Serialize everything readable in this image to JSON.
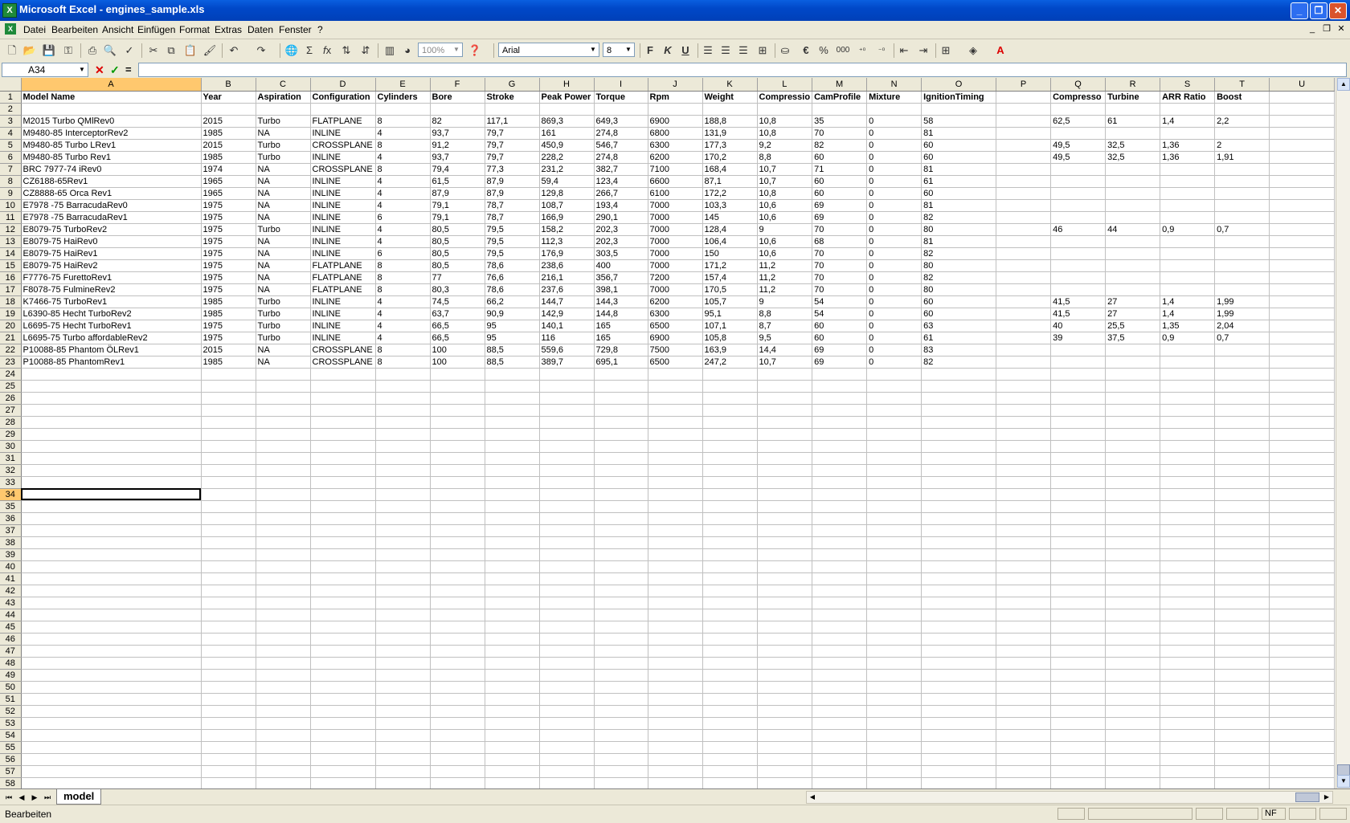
{
  "window": {
    "title": "Microsoft Excel - engines_sample.xls"
  },
  "menu": [
    "Datei",
    "Bearbeiten",
    "Ansicht",
    "Einfügen",
    "Format",
    "Extras",
    "Daten",
    "Fenster",
    "?"
  ],
  "toolbar": {
    "zoom": "100%",
    "font": "Arial",
    "font_size": "8"
  },
  "formula_bar": {
    "name_box": "A34",
    "formula": ""
  },
  "sheet": {
    "columns": [
      "A",
      "B",
      "C",
      "D",
      "E",
      "F",
      "G",
      "H",
      "I",
      "J",
      "K",
      "L",
      "M",
      "N",
      "O",
      "P",
      "Q",
      "R",
      "S",
      "T",
      "U"
    ],
    "active_cell": {
      "row": 34,
      "col": "A"
    },
    "total_rows": 58,
    "rows": [
      [
        "Model Name",
        "Year",
        "Aspiration",
        "Configuration",
        "Cylinders",
        "Bore",
        "Stroke",
        "Peak Power",
        "Torque",
        "Rpm",
        "Weight",
        "Compressio",
        "CamProfile",
        "Mixture",
        "IgnitionTiming",
        "",
        "Compresso",
        "Turbine",
        "ARR Ratio",
        "Boost",
        ""
      ],
      [],
      [
        " M2015 Turbo QMlRev0",
        "2015",
        "Turbo",
        "FLATPLANE",
        "8",
        "82",
        "117,1",
        "869,3",
        "649,3",
        "6900",
        "188,8",
        "10,8",
        "35",
        "0",
        "58",
        "",
        "62,5",
        "61",
        "1,4",
        "2,2",
        ""
      ],
      [
        " M9480-85 InterceptorRev2",
        "1985",
        "NA",
        "INLINE",
        "4",
        "93,7",
        "79,7",
        "161",
        "274,8",
        "6800",
        "131,9",
        "10,8",
        "70",
        "0",
        "81",
        "",
        "",
        "",
        "",
        "",
        ""
      ],
      [
        " M9480-85 Turbo  LRev1",
        "2015",
        "Turbo",
        "CROSSPLANE",
        "8",
        "91,2",
        "79,7",
        "450,9",
        "546,7",
        "6300",
        "177,3",
        "9,2",
        "82",
        "0",
        "60",
        "",
        "49,5",
        "32,5",
        "1,36",
        "2",
        ""
      ],
      [
        " M9480-85 Turbo Rev1",
        "1985",
        "Turbo",
        "INLINE",
        "4",
        "93,7",
        "79,7",
        "228,2",
        "274,8",
        "6200",
        "170,2",
        "8,8",
        "60",
        "0",
        "60",
        "",
        "49,5",
        "32,5",
        "1,36",
        "1,91",
        ""
      ],
      [
        "BRC 7977-74 iRev0",
        "1974",
        "NA",
        "CROSSPLANE",
        "8",
        "79,4",
        "77,3",
        "231,2",
        "382,7",
        "7100",
        "168,4",
        "10,7",
        "71",
        "0",
        "81",
        "",
        "",
        "",
        "",
        "",
        ""
      ],
      [
        "CZ6188-65Rev1",
        "1965",
        "NA",
        "INLINE",
        "4",
        "61,5",
        "87,9",
        "59,4",
        "123,4",
        "6600",
        "87,1",
        "10,7",
        "60",
        "0",
        "61",
        "",
        "",
        "",
        "",
        "",
        ""
      ],
      [
        "CZ8888-65 Orca Rev1",
        "1965",
        "NA",
        "INLINE",
        "4",
        "87,9",
        "87,9",
        "129,8",
        "266,7",
        "6100",
        "172,2",
        "10,8",
        "60",
        "0",
        "60",
        "",
        "",
        "",
        "",
        "",
        ""
      ],
      [
        "E7978 -75 BarracudaRev0",
        "1975",
        "NA",
        "INLINE",
        "4",
        "79,1",
        "78,7",
        "108,7",
        "193,4",
        "7000",
        "103,3",
        "10,6",
        "69",
        "0",
        "81",
        "",
        "",
        "",
        "",
        "",
        ""
      ],
      [
        "E7978 -75 BarracudaRev1",
        "1975",
        "NA",
        "INLINE",
        "6",
        "79,1",
        "78,7",
        "166,9",
        "290,1",
        "7000",
        "145",
        "10,6",
        "69",
        "0",
        "82",
        "",
        "",
        "",
        "",
        "",
        ""
      ],
      [
        "E8079-75  TurboRev2",
        "1975",
        "Turbo",
        "INLINE",
        "4",
        "80,5",
        "79,5",
        "158,2",
        "202,3",
        "7000",
        "128,4",
        "9",
        "70",
        "0",
        "80",
        "",
        "46",
        "44",
        "0,9",
        "0,7",
        ""
      ],
      [
        "E8079-75 HaiRev0",
        "1975",
        "NA",
        "INLINE",
        "4",
        "80,5",
        "79,5",
        "112,3",
        "202,3",
        "7000",
        "106,4",
        "10,6",
        "68",
        "0",
        "81",
        "",
        "",
        "",
        "",
        "",
        ""
      ],
      [
        "E8079-75 HaiRev1",
        "1975",
        "NA",
        "INLINE",
        "6",
        "80,5",
        "79,5",
        "176,9",
        "303,5",
        "7000",
        "150",
        "10,6",
        "70",
        "0",
        "82",
        "",
        "",
        "",
        "",
        "",
        ""
      ],
      [
        "E8079-75 HaiRev2",
        "1975",
        "NA",
        "FLATPLANE",
        "8",
        "80,5",
        "78,6",
        "238,6",
        "400",
        "7000",
        "171,2",
        "11,2",
        "70",
        "0",
        "80",
        "",
        "",
        "",
        "",
        "",
        ""
      ],
      [
        "F7776-75 FurettoRev1",
        "1975",
        "NA",
        "FLATPLANE",
        "8",
        "77",
        "76,6",
        "216,1",
        "356,7",
        "7200",
        "157,4",
        "11,2",
        "70",
        "0",
        "82",
        "",
        "",
        "",
        "",
        "",
        ""
      ],
      [
        "F8078-75 FulmineRev2",
        "1975",
        "NA",
        "FLATPLANE",
        "8",
        "80,3",
        "78,6",
        "237,6",
        "398,1",
        "7000",
        "170,5",
        "11,2",
        "70",
        "0",
        "80",
        "",
        "",
        "",
        "",
        "",
        ""
      ],
      [
        "K7466-75 TurboRev1",
        "1985",
        "Turbo",
        "INLINE",
        "4",
        "74,5",
        "66,2",
        "144,7",
        "144,3",
        "6200",
        "105,7",
        "9",
        "54",
        "0",
        "60",
        "",
        "41,5",
        "27",
        "1,4",
        "1,99",
        ""
      ],
      [
        "L6390-85 Hecht TurboRev2",
        "1985",
        "Turbo",
        "INLINE",
        "4",
        "63,7",
        "90,9",
        "142,9",
        "144,8",
        "6300",
        "95,1",
        "8,8",
        "54",
        "0",
        "60",
        "",
        "41,5",
        "27",
        "1,4",
        "1,99",
        ""
      ],
      [
        "L6695-75 Hecht TurboRev1",
        "1975",
        "Turbo",
        "INLINE",
        "4",
        "66,5",
        "95",
        "140,1",
        "165",
        "6500",
        "107,1",
        "8,7",
        "60",
        "0",
        "63",
        "",
        "40",
        "25,5",
        "1,35",
        "2,04",
        ""
      ],
      [
        "L6695-75 Turbo affordableRev2",
        "1975",
        "Turbo",
        "INLINE",
        "4",
        "66,5",
        "95",
        "116",
        "165",
        "6900",
        "105,8",
        "9,5",
        "60",
        "0",
        "61",
        "",
        "39",
        "37,5",
        "0,9",
        "0,7",
        ""
      ],
      [
        "P10088-85 Phantom ÖLRev1",
        "2015",
        "NA",
        "CROSSPLANE",
        "8",
        "100",
        "88,5",
        "559,6",
        "729,8",
        "7500",
        "163,9",
        "14,4",
        "69",
        "0",
        "83",
        "",
        "",
        "",
        "",
        "",
        ""
      ],
      [
        "P10088-85 PhantomRev1",
        "1985",
        "NA",
        "CROSSPLANE",
        "8",
        "100",
        "88,5",
        "389,7",
        "695,1",
        "6500",
        "247,2",
        "10,7",
        "69",
        "0",
        "82",
        "",
        "",
        "",
        "",
        "",
        ""
      ]
    ]
  },
  "sheet_tabs": [
    "model"
  ],
  "status": {
    "mode": "Bearbeiten",
    "indicator": "NF"
  }
}
